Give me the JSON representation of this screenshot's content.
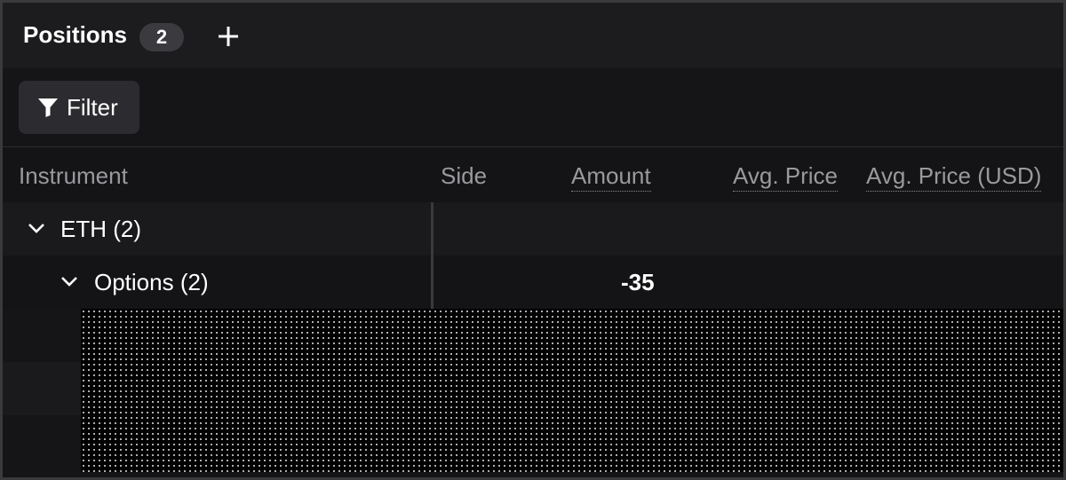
{
  "panel": {
    "title": "Positions",
    "count": "2",
    "add_icon": "plus-icon"
  },
  "toolbar": {
    "filter_label": "Filter",
    "filter_icon": "funnel-icon"
  },
  "columns": {
    "instrument": "Instrument",
    "side": "Side",
    "amount": "Amount",
    "avg_price": "Avg. Price",
    "avg_price_usd": "Avg. Price (USD)"
  },
  "rows": {
    "eth": {
      "label": "ETH (2)"
    },
    "options": {
      "label": "Options (2)",
      "amount": "-35"
    }
  },
  "colors": {
    "background": "#141416",
    "header": "#1c1c1e",
    "text": "#ffffff",
    "muted_text": "#9a9a9e"
  }
}
